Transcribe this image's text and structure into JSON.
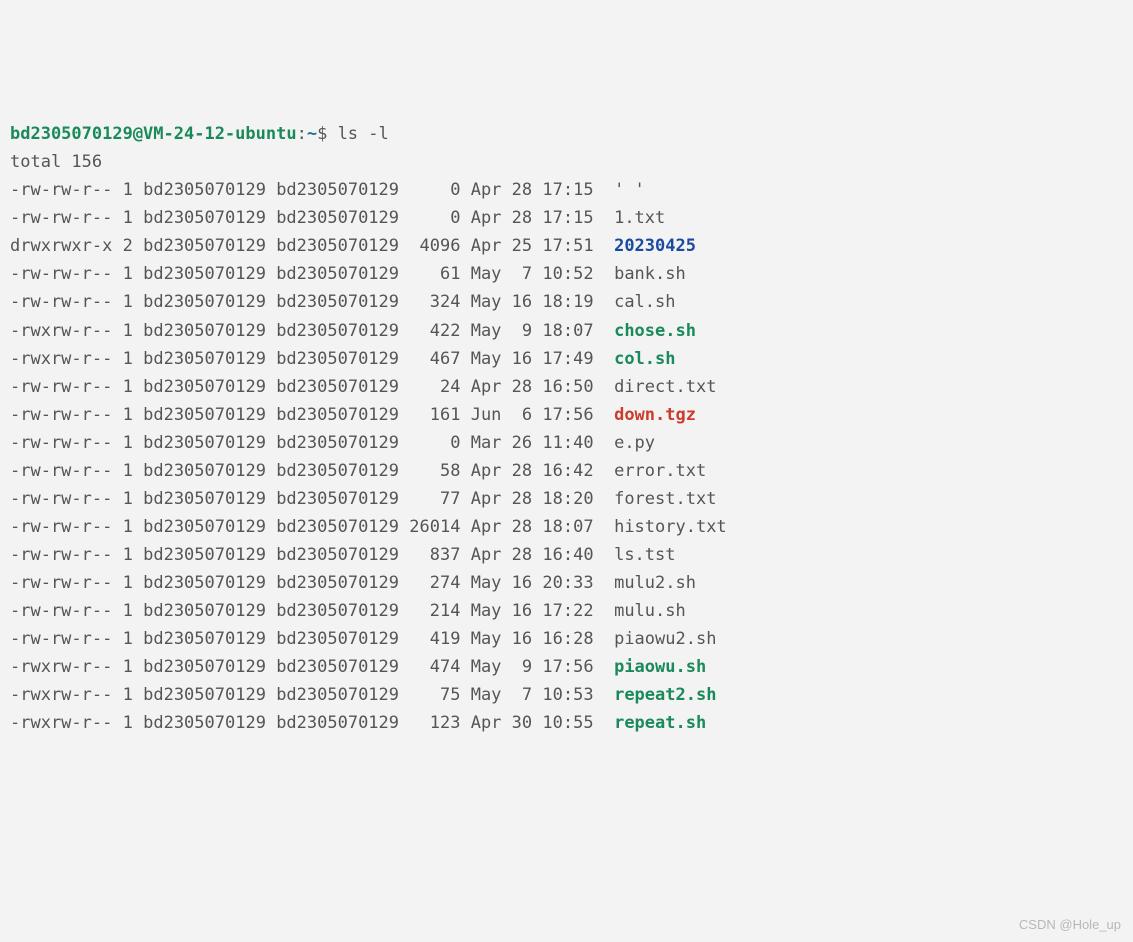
{
  "prompt": {
    "user_host": "bd2305070129@VM-24-12-ubuntu",
    "sep1": ":",
    "path": "~",
    "sep2": "$ ",
    "command": "ls -l"
  },
  "total_line": "total 156",
  "owner": "bd2305070129",
  "group": "bd2305070129",
  "files": [
    {
      "perm": "-rw-rw-r--",
      "links": "1",
      "size": "0",
      "month": "Apr",
      "day": "28",
      "time": "17:15",
      "name": "' '",
      "class": "f-reg"
    },
    {
      "perm": "-rw-rw-r--",
      "links": "1",
      "size": "0",
      "month": "Apr",
      "day": "28",
      "time": "17:15",
      "name": "1.txt",
      "class": "f-reg"
    },
    {
      "perm": "drwxrwxr-x",
      "links": "2",
      "size": "4096",
      "month": "Apr",
      "day": "25",
      "time": "17:51",
      "name": "20230425",
      "class": "f-dir"
    },
    {
      "perm": "-rw-rw-r--",
      "links": "1",
      "size": "61",
      "month": "May",
      "day": "7",
      "time": "10:52",
      "name": "bank.sh",
      "class": "f-reg"
    },
    {
      "perm": "-rw-rw-r--",
      "links": "1",
      "size": "324",
      "month": "May",
      "day": "16",
      "time": "18:19",
      "name": "cal.sh",
      "class": "f-reg"
    },
    {
      "perm": "-rwxrw-r--",
      "links": "1",
      "size": "422",
      "month": "May",
      "day": "9",
      "time": "18:07",
      "name": "chose.sh",
      "class": "f-exec"
    },
    {
      "perm": "-rwxrw-r--",
      "links": "1",
      "size": "467",
      "month": "May",
      "day": "16",
      "time": "17:49",
      "name": "col.sh",
      "class": "f-exec"
    },
    {
      "perm": "-rw-rw-r--",
      "links": "1",
      "size": "24",
      "month": "Apr",
      "day": "28",
      "time": "16:50",
      "name": "direct.txt",
      "class": "f-reg"
    },
    {
      "perm": "-rw-rw-r--",
      "links": "1",
      "size": "161",
      "month": "Jun",
      "day": "6",
      "time": "17:56",
      "name": "down.tgz",
      "class": "f-arch"
    },
    {
      "perm": "-rw-rw-r--",
      "links": "1",
      "size": "0",
      "month": "Mar",
      "day": "26",
      "time": "11:40",
      "name": "e.py",
      "class": "f-reg"
    },
    {
      "perm": "-rw-rw-r--",
      "links": "1",
      "size": "58",
      "month": "Apr",
      "day": "28",
      "time": "16:42",
      "name": "error.txt",
      "class": "f-reg"
    },
    {
      "perm": "-rw-rw-r--",
      "links": "1",
      "size": "77",
      "month": "Apr",
      "day": "28",
      "time": "18:20",
      "name": "forest.txt",
      "class": "f-reg"
    },
    {
      "perm": "-rw-rw-r--",
      "links": "1",
      "size": "26014",
      "month": "Apr",
      "day": "28",
      "time": "18:07",
      "name": "history.txt",
      "class": "f-reg"
    },
    {
      "perm": "-rw-rw-r--",
      "links": "1",
      "size": "837",
      "month": "Apr",
      "day": "28",
      "time": "16:40",
      "name": "ls.tst",
      "class": "f-reg"
    },
    {
      "perm": "-rw-rw-r--",
      "links": "1",
      "size": "274",
      "month": "May",
      "day": "16",
      "time": "20:33",
      "name": "mulu2.sh",
      "class": "f-reg"
    },
    {
      "perm": "-rw-rw-r--",
      "links": "1",
      "size": "214",
      "month": "May",
      "day": "16",
      "time": "17:22",
      "name": "mulu.sh",
      "class": "f-reg"
    },
    {
      "perm": "-rw-rw-r--",
      "links": "1",
      "size": "419",
      "month": "May",
      "day": "16",
      "time": "16:28",
      "name": "piaowu2.sh",
      "class": "f-reg"
    },
    {
      "perm": "-rwxrw-r--",
      "links": "1",
      "size": "474",
      "month": "May",
      "day": "9",
      "time": "17:56",
      "name": "piaowu.sh",
      "class": "f-exec"
    },
    {
      "perm": "-rwxrw-r--",
      "links": "1",
      "size": "75",
      "month": "May",
      "day": "7",
      "time": "10:53",
      "name": "repeat2.sh",
      "class": "f-exec"
    },
    {
      "perm": "-rwxrw-r--",
      "links": "1",
      "size": "123",
      "month": "Apr",
      "day": "30",
      "time": "10:55",
      "name": "repeat.sh",
      "class": "f-exec"
    }
  ],
  "watermark": "CSDN @Hole_up"
}
